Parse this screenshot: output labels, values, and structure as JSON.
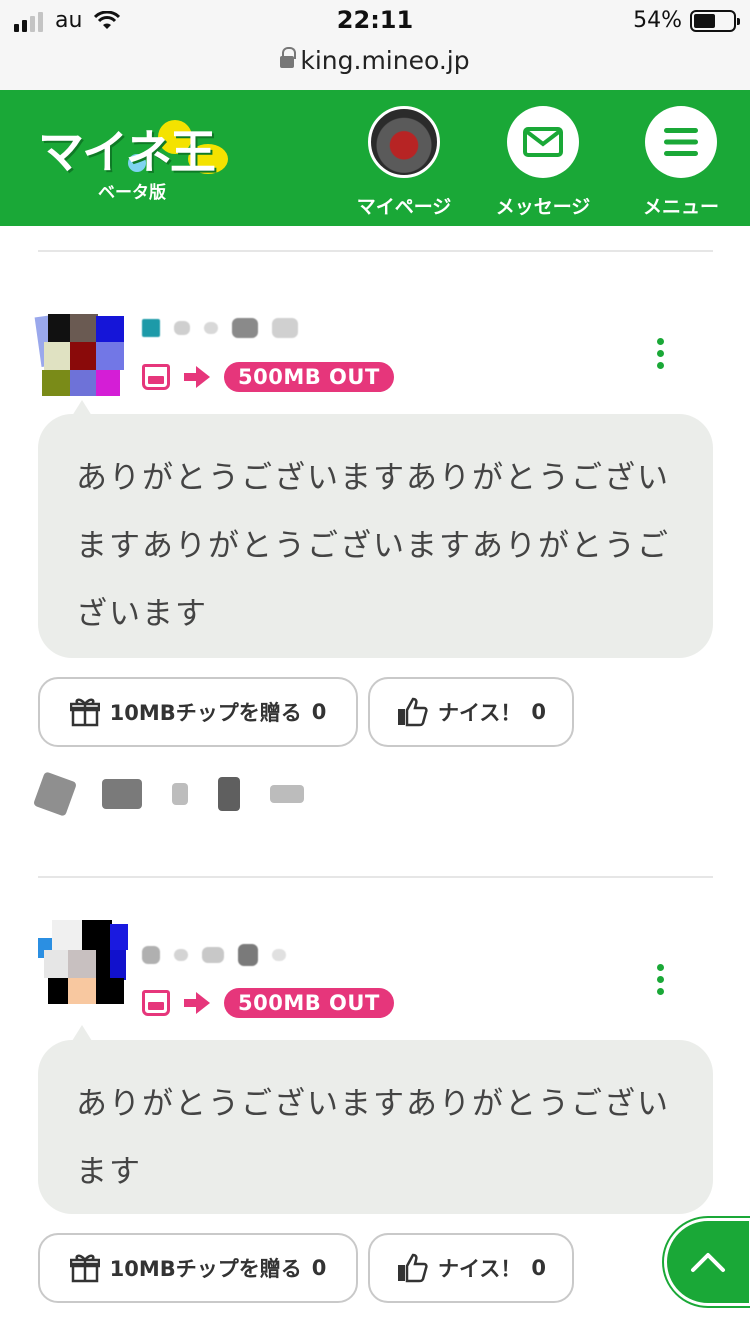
{
  "status_bar": {
    "carrier": "au",
    "time": "22:11",
    "battery": "54%",
    "battery_level": 0.54
  },
  "browser": {
    "url": "king.mineo.jp"
  },
  "header": {
    "logo_text": "マイネ王",
    "logo_sub": "ベータ版",
    "nav": [
      {
        "label": "マイページ",
        "icon": "avatar"
      },
      {
        "label": "メッセージ",
        "icon": "envelope-icon"
      },
      {
        "label": "メニュー",
        "icon": "hamburger-icon"
      }
    ]
  },
  "posts": [
    {
      "gift_badge": "500MB OUT",
      "message": "ありがとうございますありがとうございますありがとうございますありがとうございます",
      "tip_label": "10MBチップを贈る",
      "tip_count": "0",
      "nice_label": "ナイス！",
      "nice_count": "0"
    },
    {
      "gift_badge": "500MB OUT",
      "message": "ありがとうございますありがとうございます",
      "tip_label": "10MBチップを贈る",
      "tip_count": "0",
      "nice_label": "ナイス！",
      "nice_count": "0"
    }
  ],
  "colors": {
    "brand_green": "#1aa837",
    "accent_pink": "#e6367b",
    "bubble_bg": "#ebedea"
  }
}
